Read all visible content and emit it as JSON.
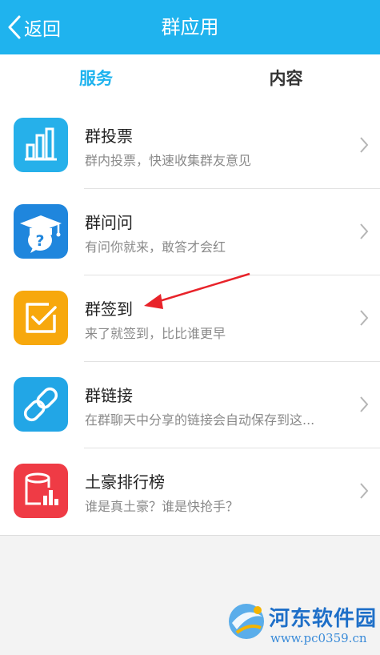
{
  "header": {
    "back_label": "返回",
    "title": "群应用",
    "accent_color": "#1fb3ee"
  },
  "tabs": [
    {
      "label": "服务",
      "active": true
    },
    {
      "label": "内容",
      "active": false
    }
  ],
  "apps": [
    {
      "name": "群投票",
      "description": "群内投票，快速收集群友意见",
      "icon": "bar-chart-icon",
      "color": "#26b0ea"
    },
    {
      "name": "群问问",
      "description": "有问你就来，敢答才会红",
      "icon": "graduation-cap-question-icon",
      "color": "#1f86dd"
    },
    {
      "name": "群签到",
      "description": "来了就签到，比比谁更早",
      "icon": "checkbox-icon",
      "color": "#f7a80d"
    },
    {
      "name": "群链接",
      "description": "在群聊天中分享的链接会自动保存到这...",
      "icon": "chain-link-icon",
      "color": "#22a6e6"
    },
    {
      "name": "土豪排行榜",
      "description": "谁是真土豪？谁是快抢手？",
      "icon": "ranking-icon",
      "color": "#ef3b45"
    }
  ],
  "annotation": {
    "target": "群签到",
    "color": "#e8232a"
  },
  "watermark": {
    "text": "河东软件园",
    "url": "www.pc0359.cn"
  }
}
